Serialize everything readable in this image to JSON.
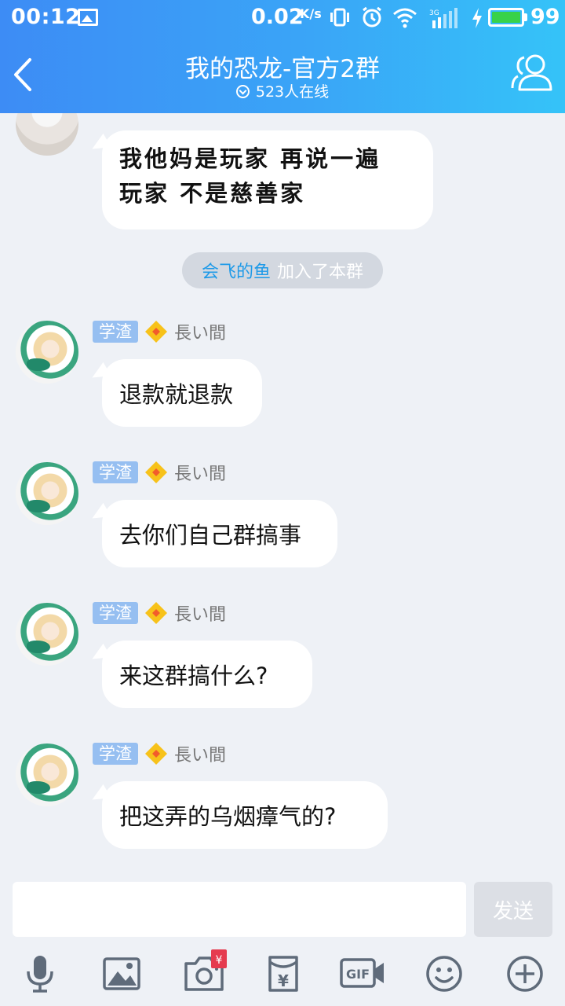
{
  "status_bar": {
    "time": "00:12",
    "net_speed": "0.02",
    "net_speed_unit": "K/s",
    "network_type": "3G",
    "battery_level": 0.99,
    "battery_text": "99",
    "battery_color": "#38d24a"
  },
  "header": {
    "title": "我的恐龙-官方2群",
    "online": "523人在线",
    "gradient": [
      "#3d8cf5",
      "#35c3f8"
    ]
  },
  "messages": [
    {
      "type": "text",
      "text": "我他妈是玩家 再说一遍 玩家 不是慈善家"
    },
    {
      "type": "system",
      "user": "会飞的鱼",
      "text": "加入了本群"
    },
    {
      "type": "text",
      "badge": "学渣",
      "name": "長い間",
      "text": "退款就退款"
    },
    {
      "type": "text",
      "badge": "学渣",
      "name": "長い間",
      "text": "去你们自己群搞事"
    },
    {
      "type": "text",
      "badge": "学渣",
      "name": "長い間",
      "text": "来这群搞什么?"
    },
    {
      "type": "text",
      "badge": "学渣",
      "name": "長い間",
      "text": "把这弄的乌烟瘴气的?"
    }
  ],
  "input": {
    "value": "",
    "placeholder": "",
    "send_label": "发送"
  },
  "toolbar": {
    "icons": [
      "microphone-icon",
      "image-icon",
      "camera-icon",
      "red-packet-icon",
      "gif-icon",
      "emoji-icon",
      "plus-icon"
    ],
    "camera_badge": "¥",
    "red_packet_symbol": "¥",
    "gif_label": "GIF"
  }
}
